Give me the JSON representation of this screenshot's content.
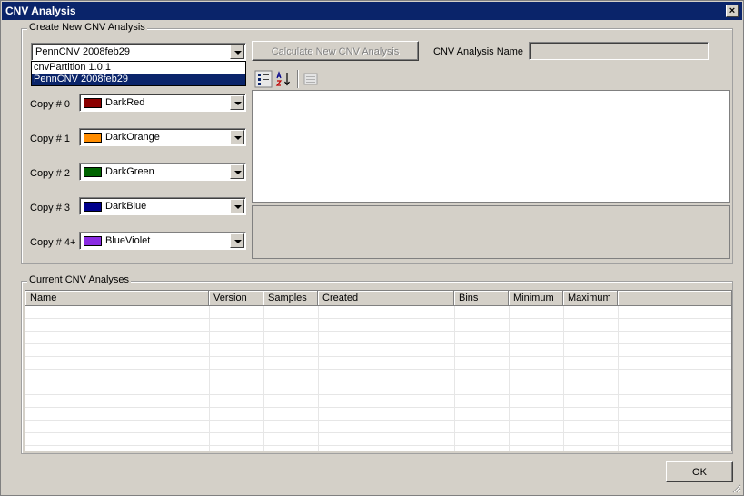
{
  "window": {
    "title": "CNV Analysis",
    "close_glyph": "×"
  },
  "create_group": {
    "label": "Create New CNV Analysis",
    "algorithm": {
      "value": "PennCNV 2008feb29",
      "options": [
        "cnvPartition 1.0.1",
        "PennCNV 2008feb29"
      ],
      "selected_index": 1
    },
    "calculate_button": "Calculate New CNV Analysis",
    "name_label": "CNV Analysis Name",
    "name_value": "",
    "copies": [
      {
        "label": "Copy # 0",
        "color_name": "DarkRed",
        "color": "#8b0000"
      },
      {
        "label": "Copy # 1",
        "color_name": "DarkOrange",
        "color": "#ff8c00"
      },
      {
        "label": "Copy # 2",
        "color_name": "DarkGreen",
        "color": "#006400"
      },
      {
        "label": "Copy # 3",
        "color_name": "DarkBlue",
        "color": "#00008b"
      },
      {
        "label": "Copy # 4+",
        "color_name": "BlueViolet",
        "color": "#8a2be2"
      }
    ],
    "toolbar_icons": [
      "categorized-icon",
      "alphabetical-sort-icon",
      "property-pages-icon"
    ]
  },
  "current_group": {
    "label": "Current CNV Analyses",
    "columns": [
      "Name",
      "Version",
      "Samples",
      "Created",
      "Bins",
      "Minimum",
      "Maximum"
    ],
    "rows": []
  },
  "ok_button": "OK"
}
